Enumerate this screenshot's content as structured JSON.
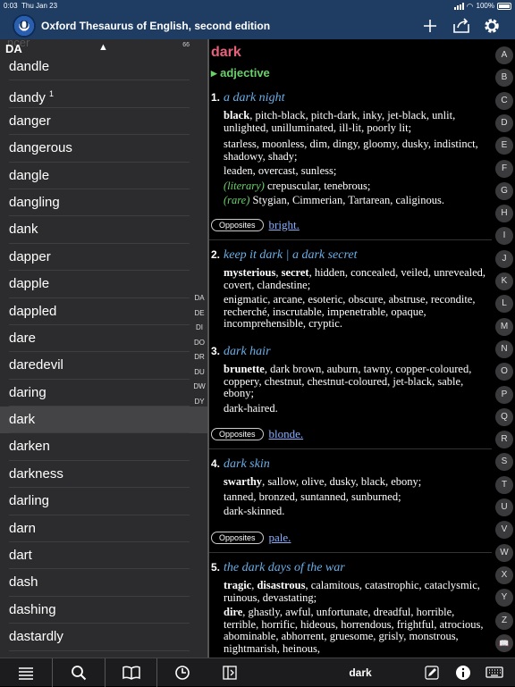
{
  "status": {
    "time": "0:03",
    "date": "Thu Jan 23",
    "battery": "100%"
  },
  "app": {
    "title": "Oxford Thesaurus of English, second edition",
    "logo_letter": "O"
  },
  "search": {
    "ghost": "ncer",
    "prefix": "DA",
    "count": "66"
  },
  "word_list": [
    {
      "word": "dandle"
    },
    {
      "word": "dandy",
      "sup": "1"
    },
    {
      "word": "danger"
    },
    {
      "word": "dangerous"
    },
    {
      "word": "dangle"
    },
    {
      "word": "dangling"
    },
    {
      "word": "dank"
    },
    {
      "word": "dapper"
    },
    {
      "word": "dapple"
    },
    {
      "word": "dappled"
    },
    {
      "word": "dare"
    },
    {
      "word": "daredevil"
    },
    {
      "word": "daring"
    },
    {
      "word": "dark",
      "selected": true
    },
    {
      "word": "darken"
    },
    {
      "word": "darkness"
    },
    {
      "word": "darling"
    },
    {
      "word": "darn"
    },
    {
      "word": "dart"
    },
    {
      "word": "dash"
    },
    {
      "word": "dashing"
    },
    {
      "word": "dastardly"
    }
  ],
  "prefix_index": [
    "DA",
    "DE",
    "DI",
    "DO",
    "DR",
    "DU",
    "DW",
    "DY"
  ],
  "entry": {
    "headword": "dark",
    "pos": "adjective",
    "senses": [
      {
        "num": "1.",
        "def": "a dark night",
        "paras": [
          "<b>black</b>, pitch-black, pitch-dark, inky, jet-black, unlit, unlighted, unilluminated, ill-lit, poorly lit;",
          "starless, moonless, dim, dingy, gloomy, dusky, indistinct, shadowy, shady;",
          "leaden, overcast, sunless;",
          "<span class=\"reg\">(literary)</span> crepuscular, tenebrous;",
          "<span class=\"reg\">(rare)</span> Stygian, Cimmerian, Tartarean, caliginous."
        ]
      },
      {
        "num": "2.",
        "def": "keep it dark | a dark secret",
        "paras": [
          "<b>mysterious</b>, <b>secret</b>, hidden, concealed, veiled, unrevealed, covert, clandestine;",
          "enigmatic, arcane, esoteric, obscure, abstruse, recondite, recherché, inscrutable, impenetrable, opaque, incomprehensible, cryptic."
        ]
      },
      {
        "num": "3.",
        "def": "dark hair",
        "paras": [
          "<b>brunette</b>, dark brown, auburn, tawny, copper-coloured, coppery, chestnut, chestnut-coloured, jet-black, sable, ebony;",
          "dark-haired."
        ]
      },
      {
        "num": "4.",
        "def": "dark skin",
        "paras": [
          "<b>swarthy</b>, sallow, olive, dusky, black, ebony;",
          "tanned, bronzed, suntanned, sunburned;",
          "dark-skinned."
        ]
      },
      {
        "num": "5.",
        "def": "the dark days of the war",
        "paras": [
          "<b>tragic</b>, <b>disastrous</b>, calamitous, catastrophic, cataclysmic, ruinous, devastating;",
          "<b>dire</b>, ghastly, awful, unfortunate, dreadful, horrible, terrible, horrific, hideous, horrendous, frightful, atrocious, abominable, abhorrent, gruesome, grisly, monstrous, nightmarish, heinous,"
        ]
      }
    ],
    "opposites": [
      {
        "label": "Opposites",
        "link": "bright."
      },
      {
        "label": "Opposites",
        "link": "blonde."
      },
      {
        "label": "Opposites",
        "link": "pale."
      }
    ]
  },
  "alphabet": [
    "A",
    "B",
    "C",
    "D",
    "E",
    "F",
    "G",
    "H",
    "I",
    "J",
    "K",
    "L",
    "M",
    "N",
    "O",
    "P",
    "Q",
    "R",
    "S",
    "T",
    "U",
    "V",
    "W",
    "X",
    "Y",
    "Z"
  ],
  "bottom": {
    "current_word": "dark"
  }
}
